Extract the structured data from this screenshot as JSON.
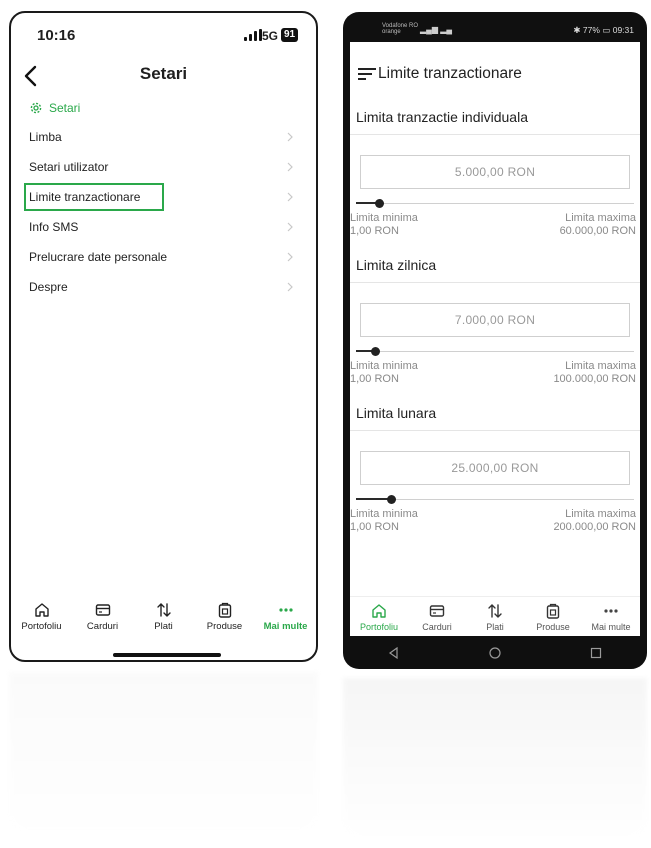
{
  "left": {
    "status": {
      "time": "10:16",
      "network": "5G",
      "battery": "91"
    },
    "title": "Setari",
    "section_label": "Setari",
    "menu_items": [
      {
        "label": "Limba"
      },
      {
        "label": "Setari utilizator"
      },
      {
        "label": "Limite tranzactionare",
        "highlighted": true
      },
      {
        "label": "Info SMS"
      },
      {
        "label": "Prelucrare date personale"
      },
      {
        "label": "Despre"
      }
    ],
    "tabs": [
      {
        "label": "Portofoliu",
        "icon": "home-icon"
      },
      {
        "label": "Carduri",
        "icon": "card-icon"
      },
      {
        "label": "Plati",
        "icon": "transfer-icon"
      },
      {
        "label": "Produse",
        "icon": "product-icon"
      },
      {
        "label": "Mai multe",
        "icon": "more-icon",
        "active": true
      }
    ],
    "accent_color": "#2aa84a"
  },
  "right": {
    "status": {
      "operator": "Vodafone RO\norange",
      "battery": "77%",
      "time": "09:31"
    },
    "title": "Limite tranzactionare",
    "limits": [
      {
        "title": "Limita tranzactie individuala",
        "value": "5.000,00 RON",
        "min_label": "Limita minima",
        "min_value": "1,00 RON",
        "max_label": "Limita maxima",
        "max_value": "60.000,00 RON",
        "fraction": 0.083
      },
      {
        "title": "Limita zilnica",
        "value": "7.000,00 RON",
        "min_label": "Limita minima",
        "min_value": "1,00 RON",
        "max_label": "Limita maxima",
        "max_value": "100.000,00 RON",
        "fraction": 0.07
      },
      {
        "title": "Limita lunara",
        "value": "25.000,00 RON",
        "min_label": "Limita minima",
        "min_value": "1,00 RON",
        "max_label": "Limita maxima",
        "max_value": "200.000,00 RON",
        "fraction": 0.125
      }
    ],
    "tabs": [
      {
        "label": "Portofoliu",
        "icon": "home-icon",
        "active": true
      },
      {
        "label": "Carduri",
        "icon": "card-icon"
      },
      {
        "label": "Plati",
        "icon": "transfer-icon"
      },
      {
        "label": "Produse",
        "icon": "product-icon"
      },
      {
        "label": "Mai multe",
        "icon": "more-icon"
      }
    ]
  }
}
